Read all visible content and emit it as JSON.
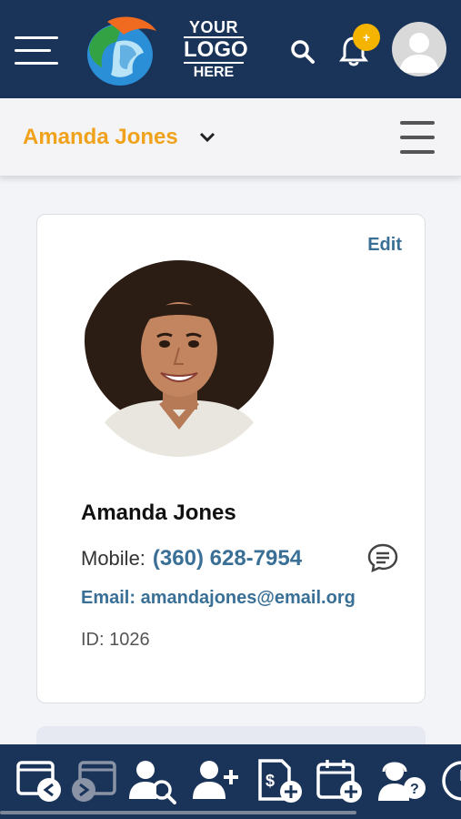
{
  "header": {
    "logo_line1": "YOUR",
    "logo_line2": "LOGO",
    "logo_line3": "HERE",
    "notification_badge": "+",
    "colors": {
      "bar": "#1a3358",
      "badge": "#f5b400"
    },
    "icons": [
      "hamburger-menu-icon",
      "globe-logo-icon",
      "search-icon",
      "bell-icon",
      "user-avatar-icon"
    ]
  },
  "subheader": {
    "selected_user": "Amanda Jones",
    "icons": [
      "chevron-down-icon",
      "menu-icon"
    ],
    "accent": "#f0a21c"
  },
  "profile": {
    "edit_label": "Edit",
    "name": "Amanda Jones",
    "mobile_label": "Mobile:",
    "mobile_number": "(360) 628-7954",
    "email_text": "Email: amandajones@email.org",
    "id_text": "ID: 1026",
    "link_color": "#3a6f96",
    "icons": [
      "profile-photo",
      "chat-bubble-icon"
    ]
  },
  "toolbar": {
    "icons": [
      "check-in-icon",
      "check-out-icon",
      "search-person-icon",
      "add-person-icon",
      "billing-add-icon",
      "calendar-add-icon",
      "support-help-icon",
      "clock-icon"
    ]
  }
}
